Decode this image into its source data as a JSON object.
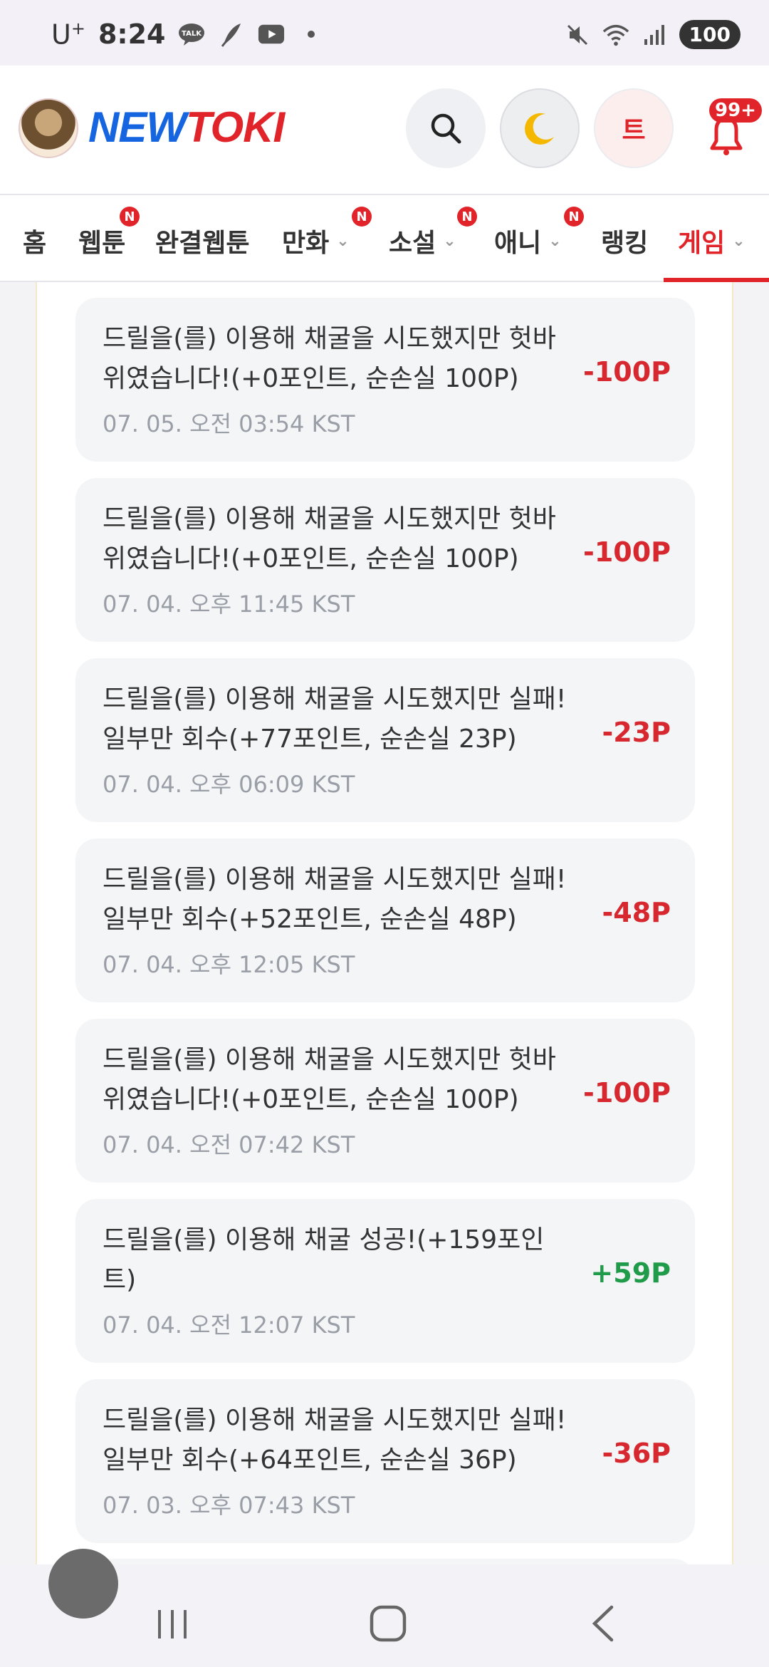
{
  "status_bar": {
    "carrier": "U",
    "carrier_sup": "+",
    "time": "8:24",
    "battery": "100",
    "icons": [
      "talk-icon",
      "feather-icon",
      "youtube-icon",
      "dot-icon",
      "mute-icon",
      "wifi-icon",
      "signal-icon"
    ]
  },
  "header": {
    "logo_new": "NEW",
    "logo_toki": "TOKI",
    "user_initial": "트",
    "notif_badge": "99+"
  },
  "nav": {
    "tabs": [
      {
        "label": "홈",
        "badge": "",
        "chevron": false
      },
      {
        "label": "웹툰",
        "badge": "N",
        "chevron": false
      },
      {
        "label": "완결웹툰",
        "badge": "",
        "chevron": false
      },
      {
        "label": "만화",
        "badge": "N",
        "chevron": true
      },
      {
        "label": "소설",
        "badge": "N",
        "chevron": true
      },
      {
        "label": "애니",
        "badge": "N",
        "chevron": true
      },
      {
        "label": "랭킹",
        "badge": "",
        "chevron": false
      },
      {
        "label": "게임",
        "badge": "",
        "chevron": true,
        "active": true
      }
    ]
  },
  "entries": [
    {
      "msg": "드릴을(를) 이용해 채굴을 시도했지만 헛바위였습니다!(+0포인트, 순손실 100P)",
      "date": "07. 05. 오전 03:54 KST",
      "points": "-100P",
      "type": "neg"
    },
    {
      "msg": "드릴을(를) 이용해 채굴을 시도했지만 헛바위였습니다!(+0포인트, 순손실 100P)",
      "date": "07. 04. 오후 11:45 KST",
      "points": "-100P",
      "type": "neg"
    },
    {
      "msg": "드릴을(를) 이용해 채굴을 시도했지만 실패! 일부만 회수(+77포인트, 순손실 23P)",
      "date": "07. 04. 오후 06:09 KST",
      "points": "-23P",
      "type": "neg"
    },
    {
      "msg": "드릴을(를) 이용해 채굴을 시도했지만 실패! 일부만 회수(+52포인트, 순손실 48P)",
      "date": "07. 04. 오후 12:05 KST",
      "points": "-48P",
      "type": "neg"
    },
    {
      "msg": "드릴을(를) 이용해 채굴을 시도했지만 헛바위였습니다!(+0포인트, 순손실 100P)",
      "date": "07. 04. 오전 07:42 KST",
      "points": "-100P",
      "type": "neg"
    },
    {
      "msg": "드릴을(를) 이용해 채굴 성공!(+159포인트)",
      "date": "07. 04. 오전 12:07 KST",
      "points": "+59P",
      "type": "pos"
    },
    {
      "msg": "드릴을(를) 이용해 채굴을 시도했지만 실패! 일부만 회수(+64포인트, 순손실 36P)",
      "date": "07. 03. 오후 07:43 KST",
      "points": "-36P",
      "type": "neg"
    }
  ],
  "colors": {
    "accent": "#e0242a",
    "brand_blue": "#1564e0",
    "negative": "#d6282e",
    "positive": "#1f9b4a"
  }
}
